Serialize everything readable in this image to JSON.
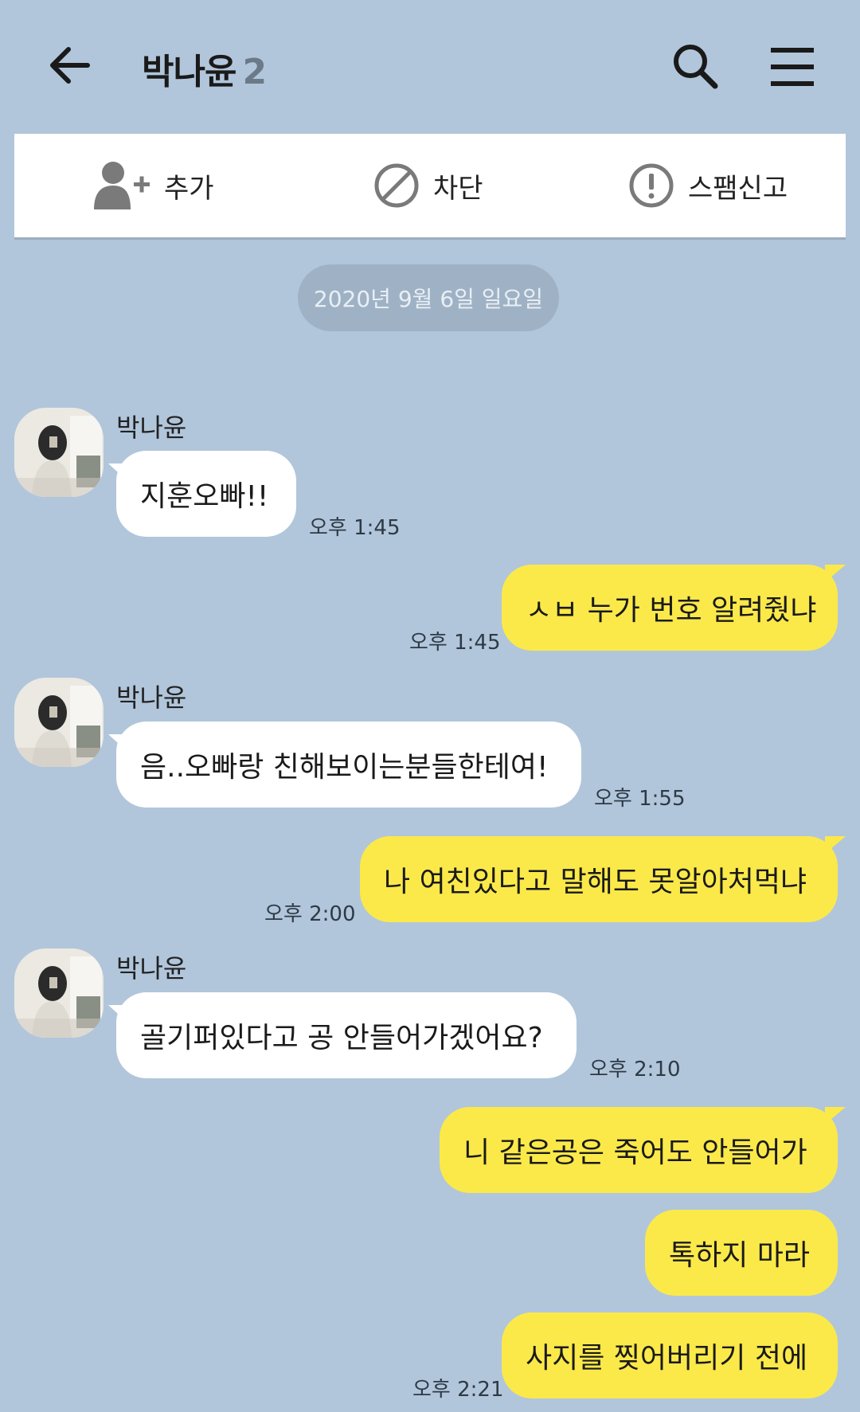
{
  "header": {
    "title": "박나윤",
    "member_count": "2",
    "back_icon": "arrow-left-icon",
    "search_icon": "search-icon",
    "menu_icon": "hamburger-menu-icon"
  },
  "actions": {
    "add_label": "추가",
    "block_label": "차단",
    "spam_label": "스팸신고"
  },
  "date_divider": "2020년 9월 6일 일요일",
  "messages": [
    {
      "sender": "박나윤",
      "text": "지훈오빠!!",
      "time": "오후 1:45"
    },
    {
      "text": "ㅅㅂ 누가 번호 알려줬냐",
      "time": "오후 1:45"
    },
    {
      "sender": "박나윤",
      "text": "음..오빠랑 친해보이는분들한테여!",
      "time": "오후 1:55"
    },
    {
      "text": "나 여친있다고 말해도 못알아처먹냐",
      "time": "오후 2:00"
    },
    {
      "sender": "박나윤",
      "text": "골기퍼있다고 공 안들어가겠어요?",
      "time": "오후 2:10"
    },
    {
      "text": "니 같은공은 죽어도 안들어가"
    },
    {
      "text": "톡하지 마라"
    },
    {
      "text": "사지를 찢어버리기 전에",
      "time": "오후 2:21"
    }
  ],
  "colors": {
    "background": "#b1c6db",
    "outgoing_bubble": "#fbe94a",
    "incoming_bubble": "#ffffff",
    "date_chip": "#9fb2c5"
  }
}
